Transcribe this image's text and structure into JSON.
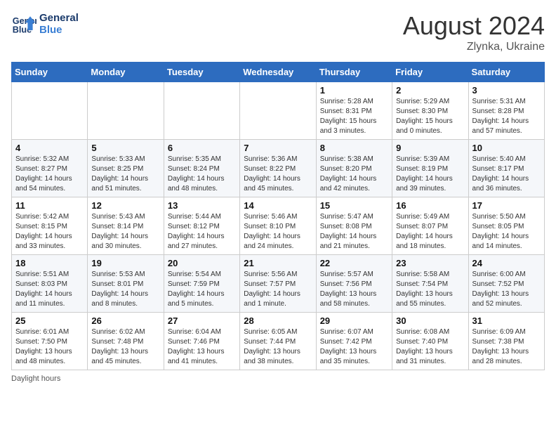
{
  "logo": {
    "line1": "General",
    "line2": "Blue"
  },
  "title": "August 2024",
  "subtitle": "Zlynka, Ukraine",
  "weekdays": [
    "Sunday",
    "Monday",
    "Tuesday",
    "Wednesday",
    "Thursday",
    "Friday",
    "Saturday"
  ],
  "weeks": [
    [
      {
        "day": "",
        "info": ""
      },
      {
        "day": "",
        "info": ""
      },
      {
        "day": "",
        "info": ""
      },
      {
        "day": "",
        "info": ""
      },
      {
        "day": "1",
        "info": "Sunrise: 5:28 AM\nSunset: 8:31 PM\nDaylight: 15 hours\nand 3 minutes."
      },
      {
        "day": "2",
        "info": "Sunrise: 5:29 AM\nSunset: 8:30 PM\nDaylight: 15 hours\nand 0 minutes."
      },
      {
        "day": "3",
        "info": "Sunrise: 5:31 AM\nSunset: 8:28 PM\nDaylight: 14 hours\nand 57 minutes."
      }
    ],
    [
      {
        "day": "4",
        "info": "Sunrise: 5:32 AM\nSunset: 8:27 PM\nDaylight: 14 hours\nand 54 minutes."
      },
      {
        "day": "5",
        "info": "Sunrise: 5:33 AM\nSunset: 8:25 PM\nDaylight: 14 hours\nand 51 minutes."
      },
      {
        "day": "6",
        "info": "Sunrise: 5:35 AM\nSunset: 8:24 PM\nDaylight: 14 hours\nand 48 minutes."
      },
      {
        "day": "7",
        "info": "Sunrise: 5:36 AM\nSunset: 8:22 PM\nDaylight: 14 hours\nand 45 minutes."
      },
      {
        "day": "8",
        "info": "Sunrise: 5:38 AM\nSunset: 8:20 PM\nDaylight: 14 hours\nand 42 minutes."
      },
      {
        "day": "9",
        "info": "Sunrise: 5:39 AM\nSunset: 8:19 PM\nDaylight: 14 hours\nand 39 minutes."
      },
      {
        "day": "10",
        "info": "Sunrise: 5:40 AM\nSunset: 8:17 PM\nDaylight: 14 hours\nand 36 minutes."
      }
    ],
    [
      {
        "day": "11",
        "info": "Sunrise: 5:42 AM\nSunset: 8:15 PM\nDaylight: 14 hours\nand 33 minutes."
      },
      {
        "day": "12",
        "info": "Sunrise: 5:43 AM\nSunset: 8:14 PM\nDaylight: 14 hours\nand 30 minutes."
      },
      {
        "day": "13",
        "info": "Sunrise: 5:44 AM\nSunset: 8:12 PM\nDaylight: 14 hours\nand 27 minutes."
      },
      {
        "day": "14",
        "info": "Sunrise: 5:46 AM\nSunset: 8:10 PM\nDaylight: 14 hours\nand 24 minutes."
      },
      {
        "day": "15",
        "info": "Sunrise: 5:47 AM\nSunset: 8:08 PM\nDaylight: 14 hours\nand 21 minutes."
      },
      {
        "day": "16",
        "info": "Sunrise: 5:49 AM\nSunset: 8:07 PM\nDaylight: 14 hours\nand 18 minutes."
      },
      {
        "day": "17",
        "info": "Sunrise: 5:50 AM\nSunset: 8:05 PM\nDaylight: 14 hours\nand 14 minutes."
      }
    ],
    [
      {
        "day": "18",
        "info": "Sunrise: 5:51 AM\nSunset: 8:03 PM\nDaylight: 14 hours\nand 11 minutes."
      },
      {
        "day": "19",
        "info": "Sunrise: 5:53 AM\nSunset: 8:01 PM\nDaylight: 14 hours\nand 8 minutes."
      },
      {
        "day": "20",
        "info": "Sunrise: 5:54 AM\nSunset: 7:59 PM\nDaylight: 14 hours\nand 5 minutes."
      },
      {
        "day": "21",
        "info": "Sunrise: 5:56 AM\nSunset: 7:57 PM\nDaylight: 14 hours\nand 1 minute."
      },
      {
        "day": "22",
        "info": "Sunrise: 5:57 AM\nSunset: 7:56 PM\nDaylight: 13 hours\nand 58 minutes."
      },
      {
        "day": "23",
        "info": "Sunrise: 5:58 AM\nSunset: 7:54 PM\nDaylight: 13 hours\nand 55 minutes."
      },
      {
        "day": "24",
        "info": "Sunrise: 6:00 AM\nSunset: 7:52 PM\nDaylight: 13 hours\nand 52 minutes."
      }
    ],
    [
      {
        "day": "25",
        "info": "Sunrise: 6:01 AM\nSunset: 7:50 PM\nDaylight: 13 hours\nand 48 minutes."
      },
      {
        "day": "26",
        "info": "Sunrise: 6:02 AM\nSunset: 7:48 PM\nDaylight: 13 hours\nand 45 minutes."
      },
      {
        "day": "27",
        "info": "Sunrise: 6:04 AM\nSunset: 7:46 PM\nDaylight: 13 hours\nand 41 minutes."
      },
      {
        "day": "28",
        "info": "Sunrise: 6:05 AM\nSunset: 7:44 PM\nDaylight: 13 hours\nand 38 minutes."
      },
      {
        "day": "29",
        "info": "Sunrise: 6:07 AM\nSunset: 7:42 PM\nDaylight: 13 hours\nand 35 minutes."
      },
      {
        "day": "30",
        "info": "Sunrise: 6:08 AM\nSunset: 7:40 PM\nDaylight: 13 hours\nand 31 minutes."
      },
      {
        "day": "31",
        "info": "Sunrise: 6:09 AM\nSunset: 7:38 PM\nDaylight: 13 hours\nand 28 minutes."
      }
    ]
  ],
  "footer": "Daylight hours"
}
